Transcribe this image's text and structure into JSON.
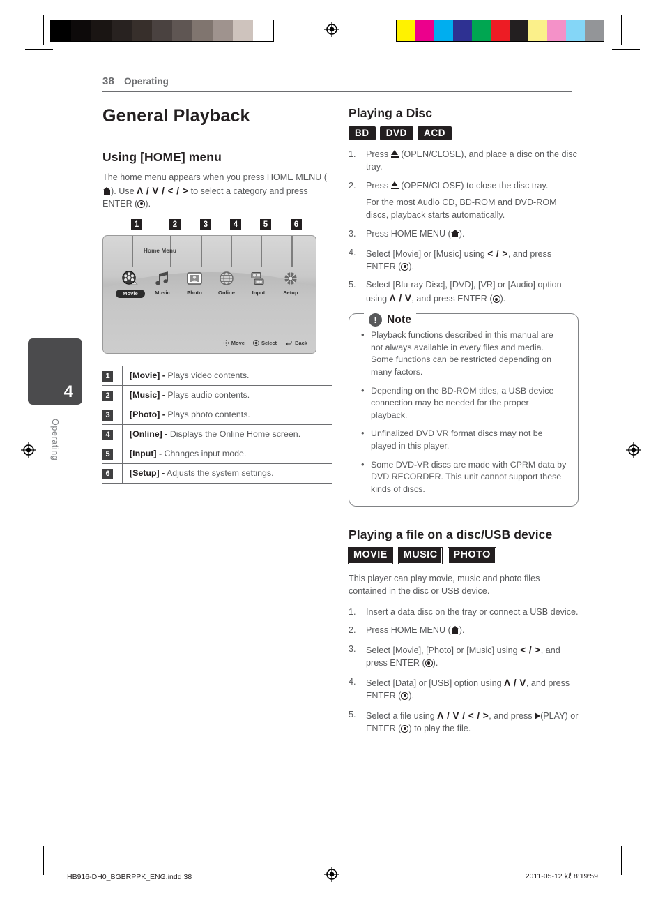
{
  "header": {
    "page_number": "38",
    "section": "Operating"
  },
  "chapter_tab": {
    "number": "4",
    "label": "Operating"
  },
  "left_column": {
    "title": "General Playback",
    "subtitle": "Using [HOME] menu",
    "intro_a": "The home menu appears when you press HOME MENU (",
    "intro_b": "). Use ",
    "intro_keys": "Λ / V / < / >",
    "intro_c": " to select a category and press ENTER (",
    "intro_d": ").",
    "callouts": [
      "1",
      "2",
      "3",
      "4",
      "5",
      "6"
    ],
    "figure": {
      "title": "Home Menu",
      "items": [
        {
          "label": "Movie",
          "icon": "film-reel-icon",
          "selected": true
        },
        {
          "label": "Music",
          "icon": "music-note-icon",
          "selected": false
        },
        {
          "label": "Photo",
          "icon": "photo-frame-icon",
          "selected": false
        },
        {
          "label": "Online",
          "icon": "globe-icon",
          "selected": false
        },
        {
          "label": "Input",
          "icon": "input-device-icon",
          "selected": false
        },
        {
          "label": "Setup",
          "icon": "gear-icon",
          "selected": false
        }
      ],
      "footer": [
        {
          "label": "Move",
          "icon": "dpad-icon"
        },
        {
          "label": "Select",
          "icon": "enter-circle-icon"
        },
        {
          "label": "Back",
          "icon": "return-arrow-icon"
        }
      ]
    },
    "legend": [
      {
        "num": "1",
        "name": "[Movie] -",
        "desc": " Plays video contents."
      },
      {
        "num": "2",
        "name": "[Music] -",
        "desc": " Plays audio contents."
      },
      {
        "num": "3",
        "name": "[Photo] -",
        "desc": " Plays photo contents."
      },
      {
        "num": "4",
        "name": "[Online] -",
        "desc": " Displays the Online Home screen."
      },
      {
        "num": "5",
        "name": "[Input] -",
        "desc": " Changes input mode."
      },
      {
        "num": "6",
        "name": "[Setup] -",
        "desc": " Adjusts the system settings."
      }
    ]
  },
  "right_column": {
    "disc_section": {
      "subtitle": "Playing a Disc",
      "badges": [
        "BD",
        "DVD",
        "ACD"
      ],
      "steps": [
        {
          "text_a": "Press ",
          "icon": "eject-icon",
          "text_b": " (OPEN/CLOSE), and place a disc on the disc tray."
        },
        {
          "text_a": "Press ",
          "icon": "eject-icon",
          "text_b": " (OPEN/CLOSE) to close the disc tray.",
          "cont": "For the most Audio CD, BD-ROM and DVD-ROM discs, playback starts automatically."
        },
        {
          "text_a": "Press HOME MENU (",
          "icon": "home-icon",
          "text_b": ")."
        },
        {
          "text_a": "Select [Movie] or [Music] using ",
          "keys": "< / >",
          "text_b": ", and press ENTER (",
          "icon2": "enter-icon",
          "text_c": ")."
        },
        {
          "text_a": "Select [Blu-ray Disc], [DVD], [VR] or [Audio] option using ",
          "keys": "Λ / V",
          "text_b": ", and press ENTER (",
          "icon2": "enter-icon",
          "text_c": ")."
        }
      ]
    },
    "note": {
      "title": "Note",
      "icon": "exclamation-icon",
      "items": [
        "Playback functions described in this manual are not always available in every files and media. Some functions can be restricted depending on many factors.",
        "Depending on the BD-ROM titles, a USB device connection may be needed for the proper playback.",
        "Unfinalized DVD VR format discs may not be played in this player.",
        "Some DVD-VR discs are made with CPRM data by DVD RECORDER. This unit cannot support these kinds of discs."
      ]
    },
    "file_section": {
      "subtitle": "Playing a file on a disc/USB device",
      "badges": [
        "MOVIE",
        "MUSIC",
        "PHOTO"
      ],
      "intro": "This player can play movie, music and photo files contained in the disc or USB device.",
      "steps": [
        {
          "text_a": "Insert a data disc on the tray or connect a USB device."
        },
        {
          "text_a": "Press HOME MENU (",
          "icon": "home-icon",
          "text_b": ")."
        },
        {
          "text_a": "Select [Movie], [Photo] or [Music] using ",
          "keys": "< / >",
          "text_b": ", and press ENTER (",
          "icon2": "enter-icon",
          "text_c": ")."
        },
        {
          "text_a": "Select [Data] or [USB] option using ",
          "keys": "Λ / V",
          "text_b": ", and press ENTER (",
          "icon2": "enter-icon",
          "text_c": ")."
        },
        {
          "text_a": "Select a file using ",
          "keys": "Λ / V / < / >",
          "text_b": ", and press ",
          "icon3": "play-icon",
          "text_c": "(PLAY) or ENTER (",
          "icon2": "enter-icon",
          "text_d": ") to play the file."
        }
      ]
    }
  },
  "footer": {
    "file_name": "HB916-DH0_BGBRPPK_ENG.indd   38",
    "timestamp": "2011-05-12   ㎘ 8:19:59"
  },
  "calibration": {
    "grayscale": [
      "#000000",
      "#0d0a0a",
      "#1a1513",
      "#282220",
      "#372f2b",
      "#4a4240",
      "#5f5653",
      "#80756f",
      "#9f938e",
      "#cec3bd",
      "#ffffff"
    ],
    "colors": [
      "#fff200",
      "#ec008c",
      "#00aeef",
      "#2e3192",
      "#00a651",
      "#ed1c24",
      "#231f20",
      "#fbf08a",
      "#f491c8",
      "#84d6f7",
      "#939598"
    ]
  }
}
